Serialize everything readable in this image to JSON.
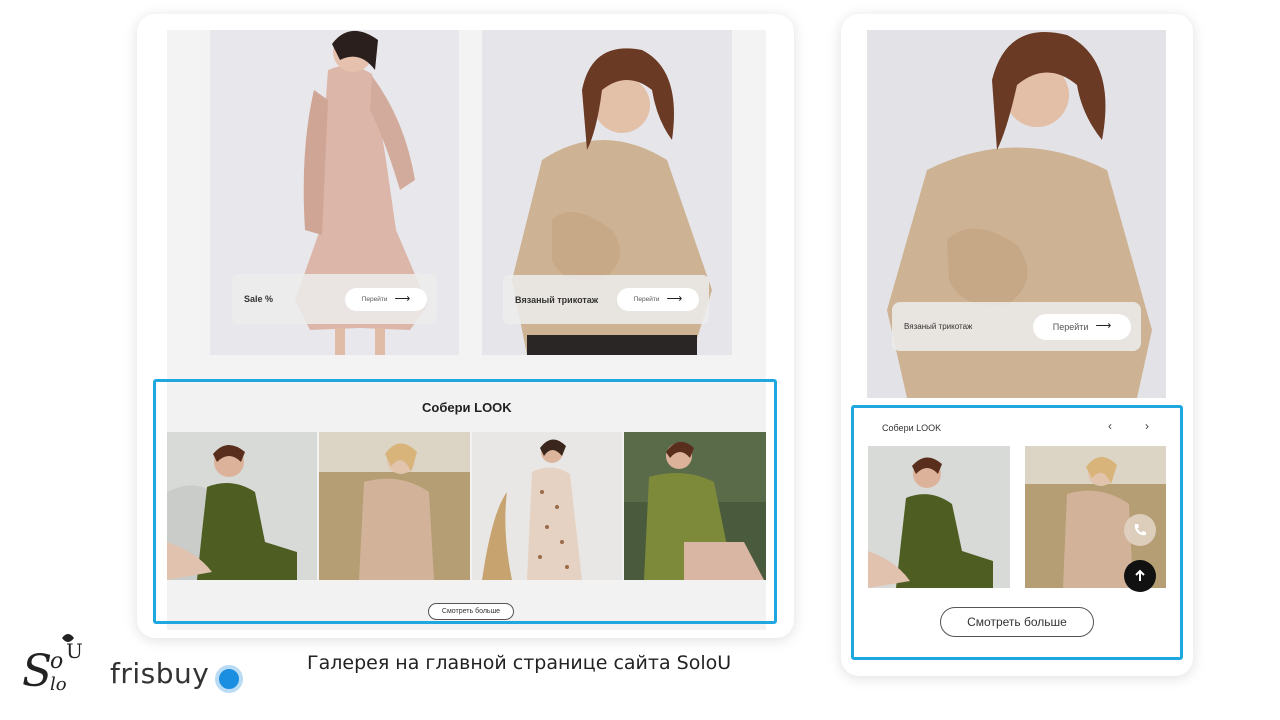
{
  "desktop": {
    "promos": [
      {
        "label": "Sale %",
        "button": "Перейти",
        "arrow": "⟶"
      },
      {
        "label": "Вязаный трикотаж",
        "button": "Перейти",
        "arrow": "⟶"
      }
    ],
    "look": {
      "title": "Собери LOOK",
      "more_button": "Смотреть больше"
    }
  },
  "mobile": {
    "promo": {
      "label": "Вязаный трикотаж",
      "button": "Перейти",
      "arrow": "⟶"
    },
    "look": {
      "title": "Собери LOOK",
      "prev": "‹",
      "next": "›",
      "more_button": "Смотреть больше"
    },
    "floating": {
      "phone_icon": "phone-icon",
      "up_icon": "arrow-up-icon"
    }
  },
  "footer": {
    "caption": "Галерея на главной странице сайта SoloU",
    "brand": "frisbuy"
  },
  "colors": {
    "highlight": "#1fa8e0",
    "frisbuy_blue": "#1a8ee0"
  }
}
